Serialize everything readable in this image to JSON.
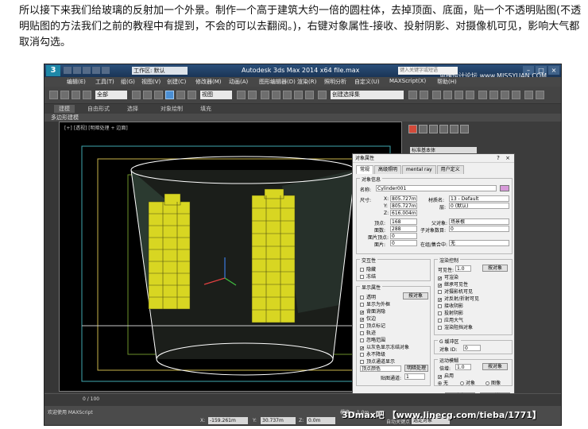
{
  "intro_text": "所以接下来我们给玻璃的反射加一个外景。制作一个高于建筑大约一倍的圆柱体，去掉顶面、底面，贴一个不透明贴图(不透明贴图的方法我们之前的教程中有提到，不会的可以去翻阅。)，右键对象属性-接收、投射阴影、对摄像机可见，影响大气都取消勾选。",
  "app": {
    "workspace": "工作区: 默认",
    "title": "Autodesk 3ds Max  2014 x64        file.max",
    "search_placeholder": "键入关键字或短语",
    "corner_watermark": "思绪设计论坛  www.MISSYUAN.COM"
  },
  "menu": [
    "编辑(E)",
    "工具(T)",
    "组(G)",
    "视图(V)",
    "创建(C)",
    "修改器(M)",
    "动画(A)",
    "图形编辑器(D)",
    "渲染(R)",
    "照明分析",
    "自定义(U)",
    "MAXScript(X)",
    "帮助(H)"
  ],
  "toolbar": {
    "selection_filter": "全部",
    "reference_coord": "视图",
    "named_selection": "创建选择集"
  },
  "ribbon": {
    "tabs": [
      "建模",
      "自由形式",
      "选择",
      "对象绘制",
      "填充"
    ],
    "subtab": "多边形建模"
  },
  "viewport": {
    "label": "[+] [透视] [明暗处理 + 边面]"
  },
  "command_panel": {
    "dropdown": "标准基本体"
  },
  "dialog": {
    "title": "对象属性",
    "tabs": [
      "常规",
      "高级照明",
      "mental ray",
      "用户定义"
    ],
    "object_info": {
      "group": "对象信息",
      "name_label": "名称:",
      "name": "Cylinder001",
      "dims_label": "尺寸:",
      "x_label": "X:",
      "x": "805.727m",
      "y_label": "Y:",
      "y": "805.727m",
      "z_label": "Z:",
      "z": "616.004m",
      "material_label": "材质名:",
      "material": "13 - Default",
      "layer_label": "层:",
      "layer": "0 (默认)",
      "verts_label": "顶点:",
      "verts": "168",
      "faces_label": "面数:",
      "faces": "288",
      "parent_label": "父对象:",
      "parent": "场景根",
      "children_label": "子对象数目:",
      "children": "0",
      "face_count_label": "面片顶点:",
      "face_count": "0",
      "patch_faces_label": "面片:",
      "patch_faces": "0",
      "group_label": "在组/集合中:",
      "group_value": "无"
    },
    "interactivity": {
      "group": "交互性",
      "hide": "隐藏",
      "freeze": "冻结"
    },
    "display_props": {
      "group": "显示属性",
      "by_object": "按对象",
      "items": [
        {
          "label": "透明",
          "checked": false
        },
        {
          "label": "显示为外框",
          "checked": false
        },
        {
          "label": "背面消隐",
          "checked": true
        },
        {
          "label": "仅边",
          "checked": true
        },
        {
          "label": "顶点标记",
          "checked": false
        },
        {
          "label": "轨迹",
          "checked": false
        },
        {
          "label": "忽略范围",
          "checked": false
        },
        {
          "label": "以灰色显示冻结对象",
          "checked": true
        },
        {
          "label": "永不降级",
          "checked": false
        },
        {
          "label": "顶点通道显示",
          "checked": false
        }
      ],
      "vertex_color": "顶点颜色",
      "shaded": "明暗处理",
      "map_channel_label": "贴图通道:",
      "map_channel": "1"
    },
    "render_control": {
      "group": "渲染控制",
      "visibility_label": "可见性:",
      "visibility": "1.0",
      "by_object": "按对象",
      "items": [
        {
          "label": "可渲染",
          "checked": true
        },
        {
          "label": "继承可见性",
          "checked": true
        },
        {
          "label": "对摄影机可见",
          "checked": false
        },
        {
          "label": "对反射/折射可见",
          "checked": true
        },
        {
          "label": "接收阴影",
          "checked": false
        },
        {
          "label": "投射阴影",
          "checked": false
        },
        {
          "label": "应用大气",
          "checked": false
        },
        {
          "label": "渲染阻挡对象",
          "checked": false
        }
      ],
      "gbuffer_label": "G 缓冲区",
      "object_id_label": "对象 ID:",
      "object_id": "0"
    },
    "motion_blur": {
      "group": "运动模糊",
      "multiplier_label": "倍增:",
      "multiplier": "1.0",
      "by_object": "按对象",
      "enabled": "启用",
      "none": "无",
      "object": "对象",
      "image": "图像"
    },
    "ok": "确定",
    "cancel": "取消"
  },
  "timeline": {
    "frame": "0 / 100"
  },
  "status": {
    "x_label": "X:",
    "x": "-159.261m",
    "y_label": "Y:",
    "y": "30.737m",
    "z_label": "Z:",
    "z": "0.0m",
    "grid_label": "栅格 = 1.0m",
    "autokey": "自动关键点",
    "selected": "选定对象",
    "welcome": "欢迎使用 MAXScript"
  },
  "watermark": "3Dmax吧 【www.linecg.com/tieba/1771】"
}
